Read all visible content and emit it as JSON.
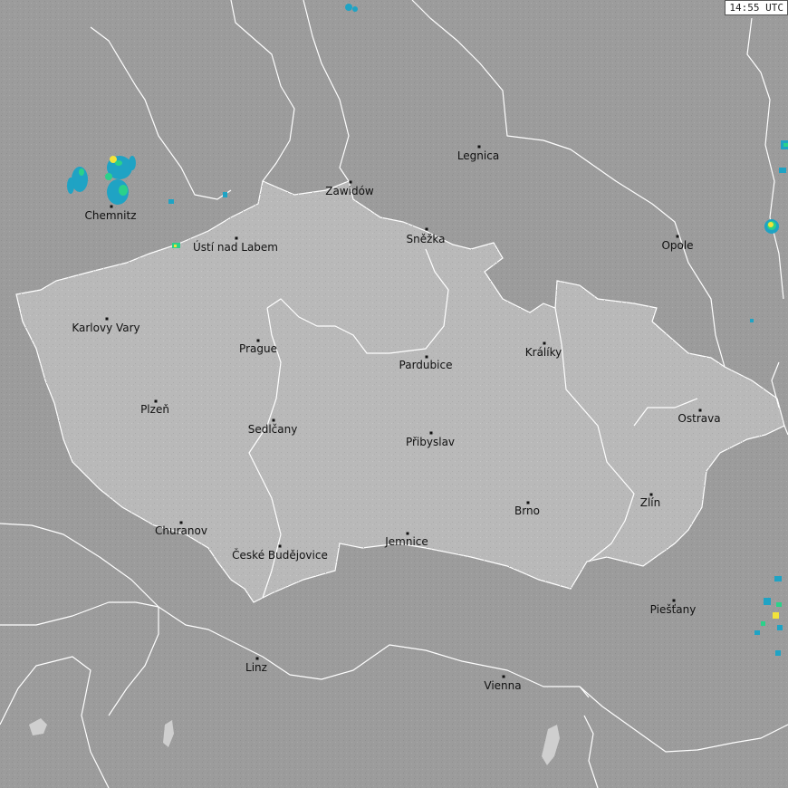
{
  "timestamp": "14:55 UTC",
  "cities": [
    {
      "id": "legnica",
      "name": "Legnica"
    },
    {
      "id": "zawidow",
      "name": "Zawidów"
    },
    {
      "id": "chemnitz",
      "name": "Chemnitz"
    },
    {
      "id": "usti",
      "name": "Ústí nad Labem"
    },
    {
      "id": "snezka",
      "name": "Sněžka"
    },
    {
      "id": "opole",
      "name": "Opole"
    },
    {
      "id": "karlovy-vary",
      "name": "Karlovy Vary"
    },
    {
      "id": "prague",
      "name": "Prague"
    },
    {
      "id": "kraliky",
      "name": "Králíky"
    },
    {
      "id": "pardubice",
      "name": "Pardubice"
    },
    {
      "id": "plzen",
      "name": "Plzeň"
    },
    {
      "id": "ostrava",
      "name": "Ostrava"
    },
    {
      "id": "sedlcany",
      "name": "Sedlčany"
    },
    {
      "id": "pribyslav",
      "name": "Přibyslav"
    },
    {
      "id": "zlin",
      "name": "Zlín"
    },
    {
      "id": "brno",
      "name": "Brno"
    },
    {
      "id": "churanov",
      "name": "Churanov"
    },
    {
      "id": "jemnice",
      "name": "Jemnice"
    },
    {
      "id": "ceske-budejovice",
      "name": "České Budějovice"
    },
    {
      "id": "piestany",
      "name": "Piešťany"
    },
    {
      "id": "linz",
      "name": "Linz"
    },
    {
      "id": "vienna",
      "name": "Vienna"
    }
  ],
  "colors": {
    "background": "#9c9c9c",
    "country_highlight": "#b9b9b9",
    "border": "#ffffff",
    "lake": "#cfcfcf",
    "radar_low": "#1fa3c4",
    "radar_mid": "#2bd18a",
    "radar_high": "#f2e33a"
  }
}
